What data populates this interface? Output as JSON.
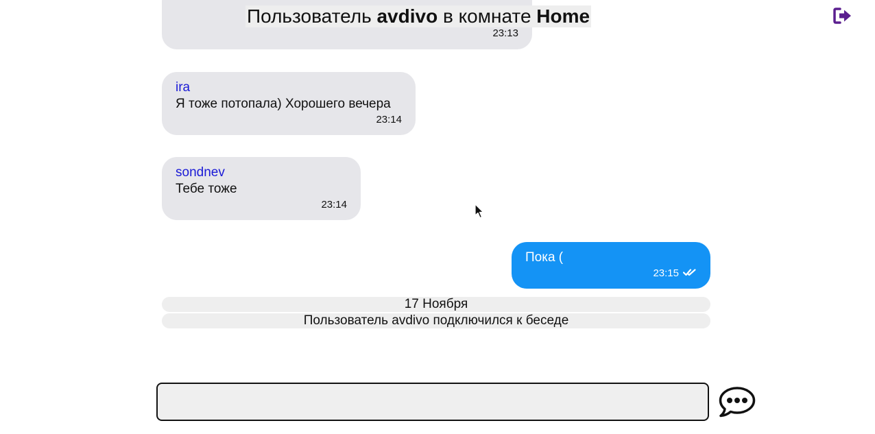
{
  "header": {
    "prefix": "Пользователь ",
    "user": "avdivo",
    "middle": " в комнате ",
    "room": "Home"
  },
  "icons": {
    "logout": "logout-icon",
    "send": "chat-bubble-icon",
    "read_status": "double-check-icon",
    "accent_color": "#5b1f8f"
  },
  "messages": [
    {
      "author": "",
      "text": "",
      "time": "23:13"
    },
    {
      "author": "ira",
      "text": "Я тоже потопала) Хорошего вечера",
      "time": "23:14"
    },
    {
      "author": "sondnev",
      "text": "Тебе тоже",
      "time": "23:14"
    },
    {
      "author": "",
      "text": "Пока (",
      "time": "23:15",
      "own": true
    }
  ],
  "system": {
    "date": "17 Ноября",
    "event": "Пользователь avdivo подключился к беседе"
  },
  "composer": {
    "value": "",
    "placeholder": ""
  },
  "colors": {
    "own_bubble": "#1493f5",
    "other_bubble": "#e6e6ea",
    "author_name": "#1a1ad6",
    "system_bar": "#eeeeee"
  }
}
